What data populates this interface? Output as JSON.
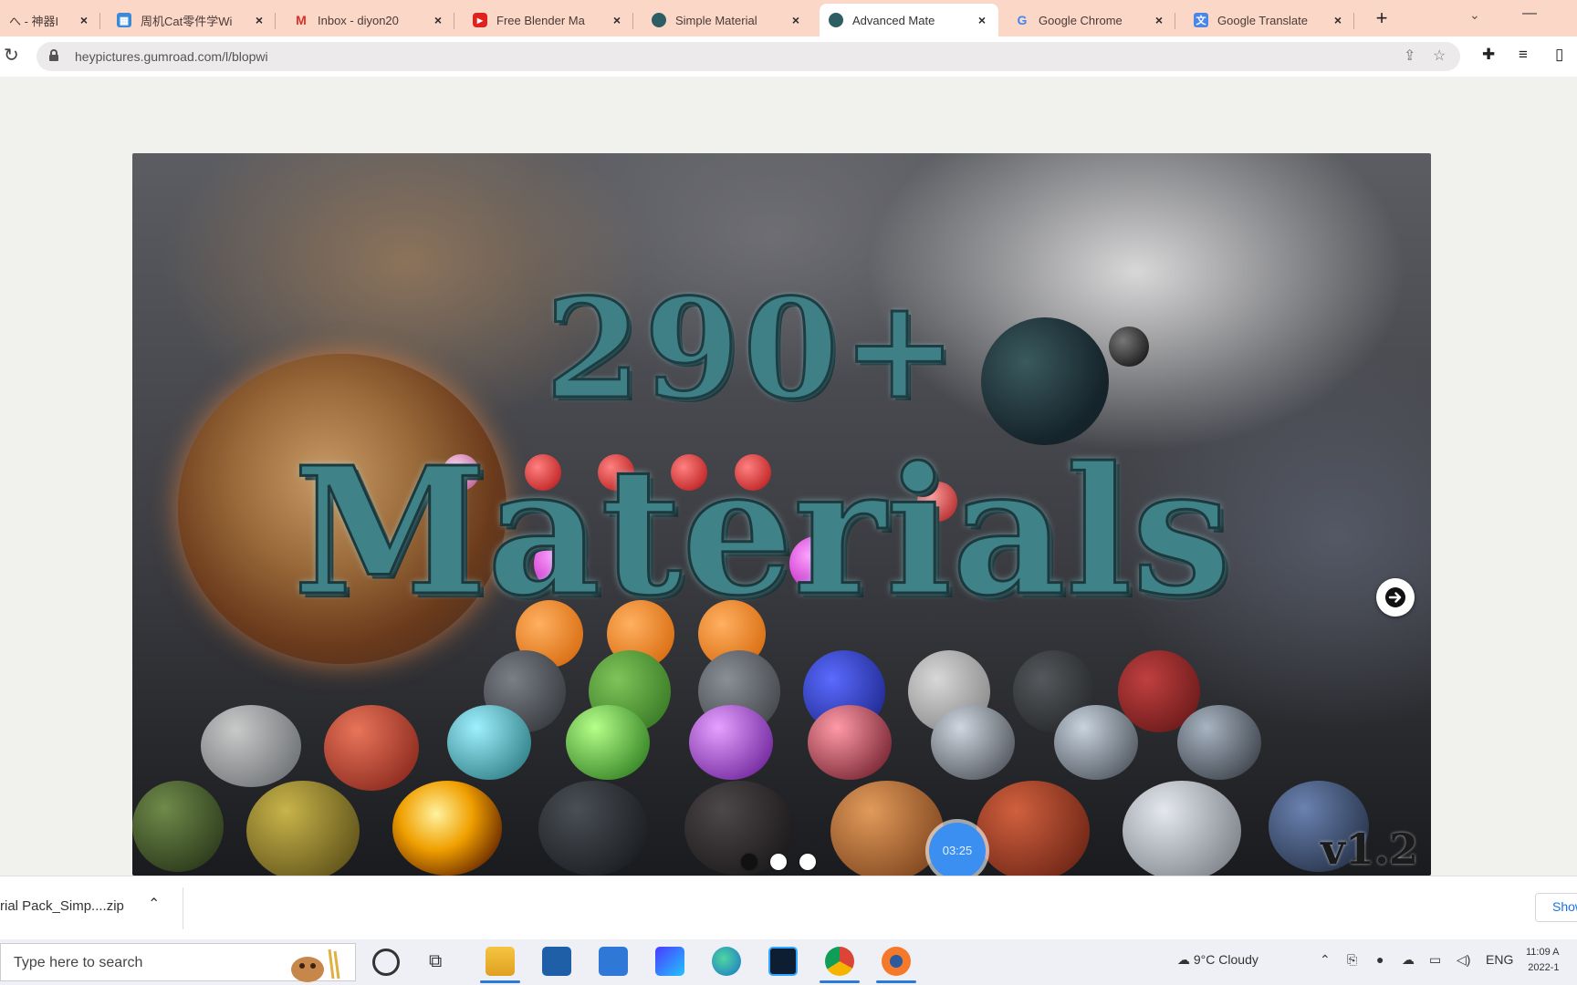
{
  "browser": {
    "tabs": [
      {
        "label": "へ - 神器I",
        "favicon": "chinese-site-icon",
        "active": false
      },
      {
        "label": "周机Cat零件学Wi",
        "favicon": "calendar-icon",
        "active": false
      },
      {
        "label": "Inbox - diyon20",
        "favicon": "gmail-icon",
        "active": false
      },
      {
        "label": "Free Blender Ma",
        "favicon": "youtube-icon",
        "active": false
      },
      {
        "label": "Simple Material",
        "favicon": "gumroad-icon",
        "active": false
      },
      {
        "label": "Advanced Mate",
        "favicon": "gumroad-icon",
        "active": true
      },
      {
        "label": "Google Chrome",
        "favicon": "google-icon",
        "active": false
      },
      {
        "label": "Google Translate",
        "favicon": "translate-icon",
        "active": false
      }
    ],
    "new_tab_symbol": "+",
    "url": "heypictures.gumroad.com/l/blopwi"
  },
  "hero": {
    "title_number": "290+",
    "title_main": "Materials",
    "version": "v1.2",
    "timer": "03:25",
    "slide_count": 3,
    "active_slide": 1
  },
  "download_bar": {
    "file_name": "rial Pack_Simp....zip",
    "show_all": "Show"
  },
  "taskbar": {
    "search_placeholder": "Type here to search",
    "weather": "9°C  Cloudy",
    "language": "ENG",
    "time": "11:09 A",
    "date": "2022-1"
  },
  "colors": {
    "tabstrip": "#fbd7c8",
    "title_teal": "#3f8389",
    "accent_blue": "#1a73e8",
    "timer_blue": "#3b8ff0"
  }
}
